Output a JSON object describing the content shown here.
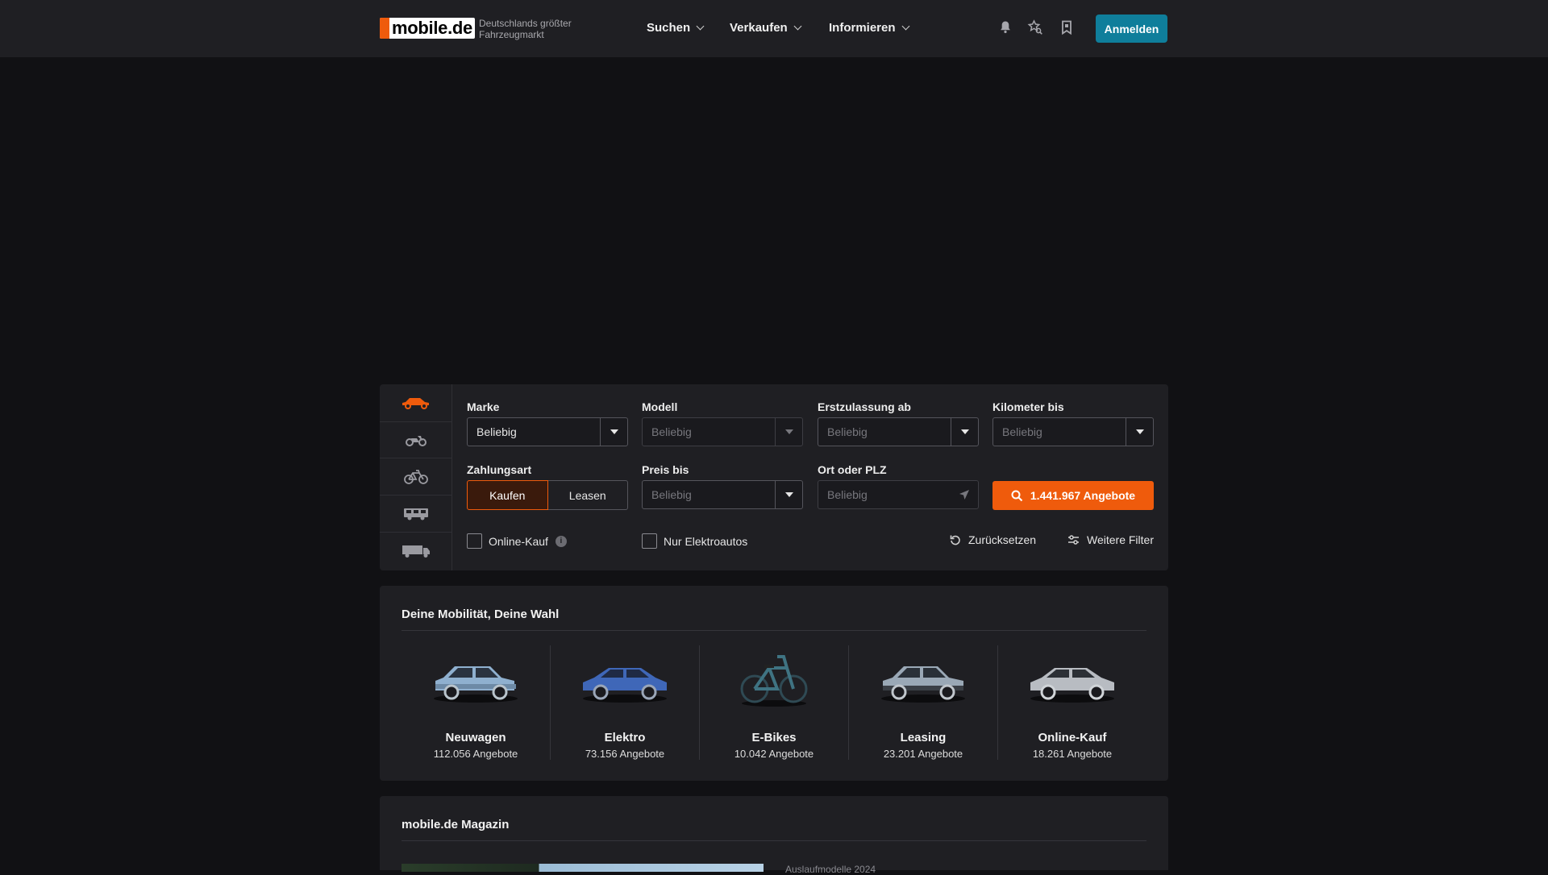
{
  "header": {
    "logo_text": "mobile.de",
    "tagline_line1": "Deutschlands größter",
    "tagline_line2": "Fahrzeugmarkt",
    "nav": [
      {
        "label": "Suchen"
      },
      {
        "label": "Verkaufen"
      },
      {
        "label": "Informieren"
      }
    ],
    "icons": [
      "bell-icon",
      "star-search-icon",
      "bookmark-icon"
    ],
    "login_label": "Anmelden"
  },
  "search": {
    "vehicle_tabs": [
      "car-icon",
      "motorcycle-icon",
      "bicycle-icon",
      "camper-icon",
      "truck-icon"
    ],
    "marke_label": "Marke",
    "marke_value": "Beliebig",
    "modell_label": "Modell",
    "modell_value": "Beliebig",
    "erstzulassung_label": "Erstzulassung ab",
    "erstzulassung_value": "Beliebig",
    "kilometer_label": "Kilometer bis",
    "kilometer_value": "Beliebig",
    "zahlungsart_label": "Zahlungsart",
    "kaufen_label": "Kaufen",
    "leasen_label": "Leasen",
    "preis_label": "Preis bis",
    "preis_value": "Beliebig",
    "ort_label": "Ort oder PLZ",
    "ort_placeholder": "Beliebig",
    "submit_label": "1.441.967 Angebote",
    "online_kauf_label": "Online-Kauf",
    "info_glyph": "i",
    "nur_elektro_label": "Nur Elektroautos",
    "reset_label": "Zurücksetzen",
    "more_filters_label": "Weitere Filter"
  },
  "mobility": {
    "title": "Deine Mobilität, Deine Wahl",
    "categories": [
      {
        "name": "Neuwagen",
        "count": "112.056 Angebote"
      },
      {
        "name": "Elektro",
        "count": "73.156 Angebote"
      },
      {
        "name": "E-Bikes",
        "count": "10.042 Angebote"
      },
      {
        "name": "Leasing",
        "count": "23.201 Angebote"
      },
      {
        "name": "Online-Kauf",
        "count": "18.261 Angebote"
      }
    ]
  },
  "magazine": {
    "title": "mobile.de Magazin",
    "teaser": "Auslaufmodelle 2024"
  },
  "colors": {
    "accent_orange": "#ef5b0c",
    "login_teal": "#0f7e9b",
    "background": "#111114",
    "panel": "#1f1f23"
  }
}
